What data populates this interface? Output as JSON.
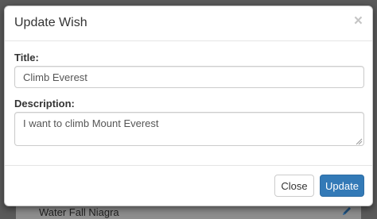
{
  "modal": {
    "title": "Update Wish",
    "close_glyph": "×",
    "title_label": "Title:",
    "title_value": "Climb Everest",
    "description_label": "Description:",
    "description_value": "I want to climb Mount Everest",
    "close_button_label": "Close",
    "update_button_label": "Update"
  },
  "background": {
    "row_text": "Water Fall Niagra",
    "row_icon": "pencil-icon"
  },
  "colors": {
    "primary": "#337ab7",
    "overlay": "#5a5a5a"
  }
}
